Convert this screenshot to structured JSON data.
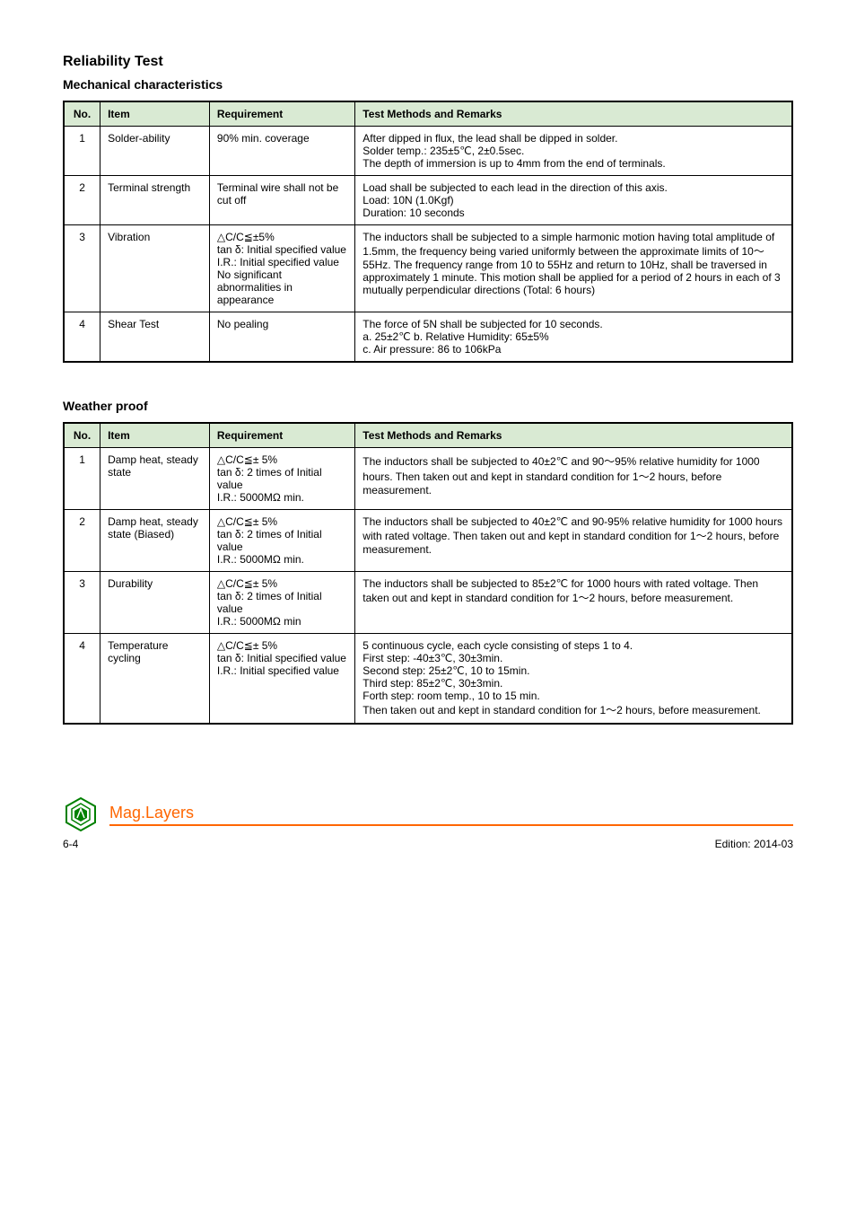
{
  "section_title": "Reliability Test",
  "sub1": "Mechanical characteristics",
  "t1": {
    "headers": [
      "No.",
      "Item",
      "Requirement",
      "Test Methods and Remarks"
    ],
    "rows": [
      {
        "no": "1",
        "item": "Solder-ability",
        "req": "90% min. coverage",
        "method": "After dipped in flux, the lead shall be dipped in solder.\nSolder temp.: 235±5℃, 2±0.5sec.\nThe depth of immersion is up to 4mm from the end of terminals."
      },
      {
        "no": "2",
        "item": "Terminal strength",
        "req": "Terminal wire shall not be cut off",
        "method": "Load shall be subjected to each lead in the direction of this axis.\nLoad: 10N (1.0Kgf)\nDuration: 10 seconds"
      },
      {
        "no": "3",
        "item": "Vibration",
        "req": "△C/C≦±5%\ntan δ: Initial specified value\nI.R.: Initial specified value\nNo significant abnormalities in appearance",
        "method": "The inductors shall be subjected to a simple harmonic motion having total amplitude of 1.5mm, the frequency being varied uniformly between the approximate limits of 10～55Hz. The frequency range from 10 to 55Hz and return to 10Hz, shall be traversed in approximately 1 minute. This motion shall be applied for a period of 2 hours in each of 3 mutually perpendicular directions (Total: 6 hours)"
      },
      {
        "no": "4",
        "item": "Shear Test",
        "req": "No pealing",
        "method": "The force of 5N shall be subjected for 10 seconds.\na. 25±2℃ b. Relative Humidity: 65±5%\nc. Air pressure: 86 to 106kPa"
      }
    ]
  },
  "sub2": "Weather proof",
  "t2": {
    "headers": [
      "No.",
      "Item",
      "Requirement",
      "Test Methods and Remarks"
    ],
    "rows": [
      {
        "no": "1",
        "item": "Damp heat, steady state",
        "req": "△C/C≦± 5%\ntan δ: 2 times of Initial value\nI.R.: 5000MΩ min.",
        "method": "The inductors shall be subjected to 40±2℃ and 90～95% relative humidity for 1000 hours. Then taken out and kept in standard condition for 1～2 hours, before measurement."
      },
      {
        "no": "2",
        "item": "Damp heat, steady state (Biased)",
        "req": "△C/C≦± 5%\ntan δ: 2 times of Initial value\nI.R.: 5000MΩ min.",
        "method": "The inductors shall be subjected to 40±2℃ and 90-95% relative humidity for 1000 hours with rated voltage. Then taken out and kept in standard condition for 1～2 hours, before measurement."
      },
      {
        "no": "3",
        "item": "Durability",
        "req": "△C/C≦± 5%\ntan δ: 2 times of Initial value\nI.R.: 5000MΩ min",
        "method": "The inductors shall be subjected to 85±2℃ for 1000 hours with rated voltage. Then taken out and kept in standard condition for 1～2 hours, before measurement."
      },
      {
        "no": "4",
        "item": "Temperature cycling",
        "req": "△C/C≦± 5%\ntan δ: Initial specified value\nI.R.: Initial specified value",
        "method": "5 continuous cycle, each cycle consisting of steps 1 to 4.\nFirst step: -40±3℃, 30±3min.\nSecond step: 25±2℃, 10 to 15min.\nThird step: 85±2℃, 30±3min.\nForth step:  room temp., 10 to 15 min.\nThen taken out and kept in standard condition for 1～2 hours, before measurement."
      }
    ]
  },
  "footer": {
    "company": "Mag.Layers",
    "left": "6-4",
    "right": "Edition: 2014-03"
  }
}
